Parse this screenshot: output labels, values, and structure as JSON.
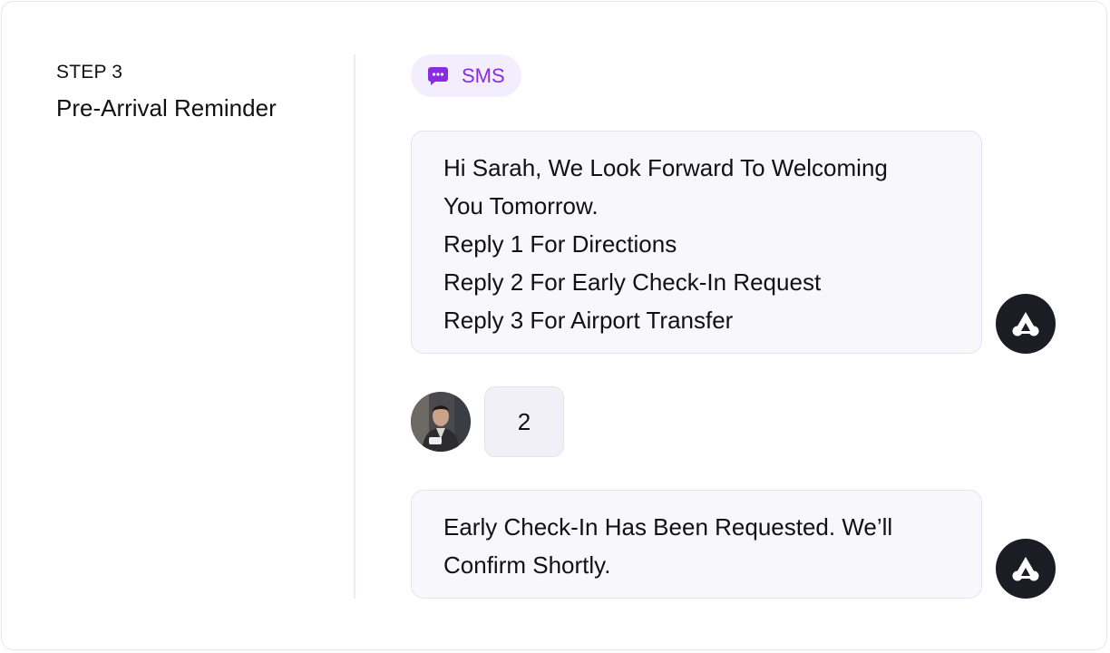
{
  "step": {
    "label": "STEP 3",
    "title": "Pre-Arrival Reminder"
  },
  "channel": {
    "icon": "chat-bubble-icon",
    "label": "SMS",
    "accent_color": "#8a2be2",
    "chip_background": "#f3eefd"
  },
  "messages": [
    {
      "sender": "brand",
      "avatar_icon": "brand-logo-icon",
      "lines": [
        "Hi Sarah, We Look Forward To Welcoming",
        "You Tomorrow.",
        "Reply 1 For Directions",
        "Reply 2 For Early Check-In Request",
        "Reply 3 For Airport Transfer"
      ]
    },
    {
      "sender": "guest",
      "avatar_icon": "guest-avatar",
      "text": "2"
    },
    {
      "sender": "brand",
      "avatar_icon": "brand-logo-icon",
      "lines": [
        "Early Check-In Has Been Requested. We’ll",
        "Confirm Shortly."
      ]
    }
  ]
}
